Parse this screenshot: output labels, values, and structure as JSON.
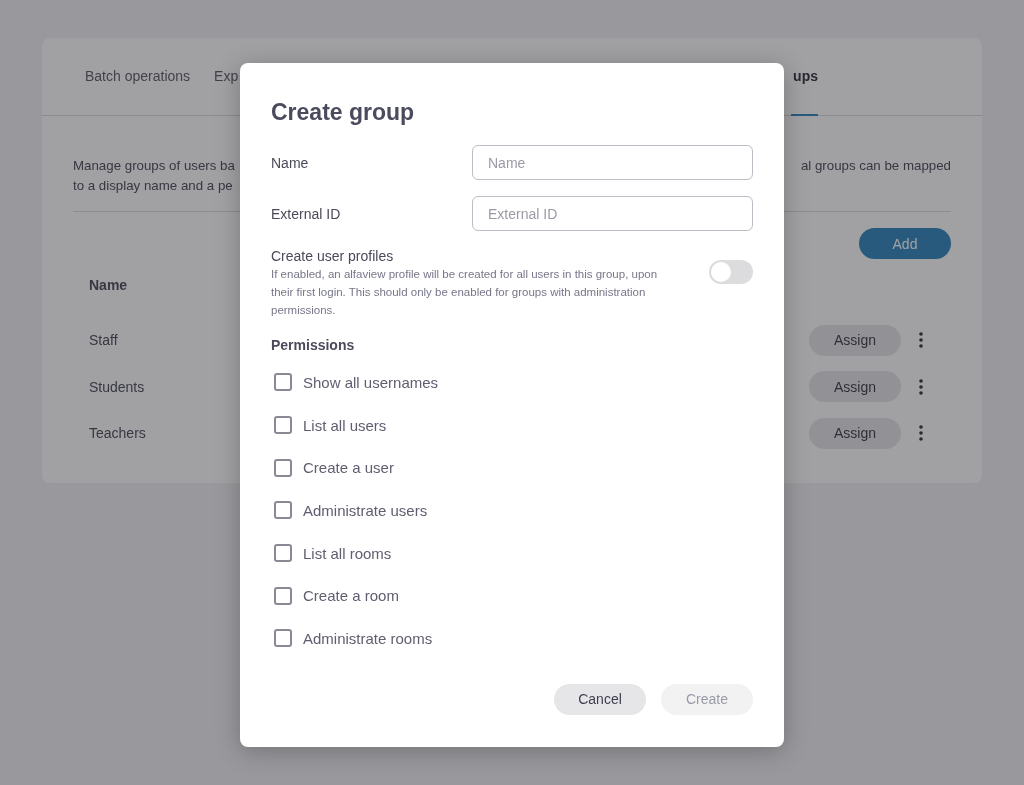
{
  "page": {
    "tabs": [
      {
        "label": "Batch operations",
        "selected": false
      },
      {
        "label": "Exp",
        "selected": false
      },
      {
        "label": "ups",
        "selected": true
      }
    ],
    "description": {
      "line_1_left": "Manage groups of users ba",
      "line_1_right": "al groups can be mapped",
      "line_2_left": "to a display name and a pe"
    },
    "add_button": "Add",
    "table": {
      "columns": [
        "Name"
      ],
      "rows": [
        {
          "name": "Staff",
          "action": "Assign"
        },
        {
          "name": "Students",
          "action": "Assign"
        },
        {
          "name": "Teachers",
          "action": "Assign"
        }
      ]
    }
  },
  "dialog": {
    "title": "Create group",
    "fields": [
      {
        "label": "Name",
        "placeholder": "Name"
      },
      {
        "label": "External ID",
        "placeholder": "External ID"
      }
    ],
    "profiles": {
      "label": "Create user profiles",
      "hint": "If enabled, an alfaview profile will be created for all users in this group, upon their first login. This should only be enabled for groups with administration permissions.",
      "on": false
    },
    "permissions_title": "Permissions",
    "permissions": [
      {
        "label": "Show all usernames",
        "checked": false
      },
      {
        "label": "List all users",
        "checked": false
      },
      {
        "label": "Create a user",
        "checked": false
      },
      {
        "label": "Administrate users",
        "checked": false
      },
      {
        "label": "List all rooms",
        "checked": false
      },
      {
        "label": "Create a room",
        "checked": false
      },
      {
        "label": "Administrate rooms",
        "checked": false
      }
    ],
    "buttons": [
      {
        "label": "Cancel",
        "disabled": false
      },
      {
        "label": "Create",
        "disabled": true
      }
    ]
  }
}
